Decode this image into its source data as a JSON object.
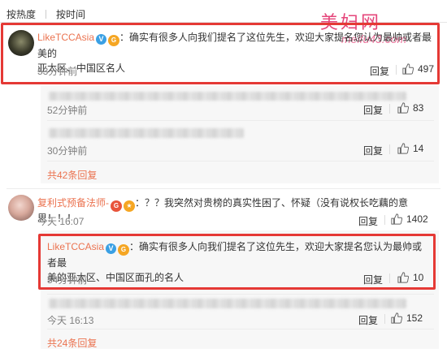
{
  "sort_tabs": [
    "按热度",
    "按时间"
  ],
  "watermark": {
    "title": "美妇网",
    "url": "meifu43.com"
  },
  "comment1": {
    "author": "LikeTCCAsia",
    "text_line1": "：确实有很多人向我们提名了这位先生，欢迎大家提名您认为最帅或者最美的",
    "text_line2": "亚太区、中国区名人",
    "time": "53分钟前",
    "reply_label": "回复",
    "likes": "497"
  },
  "sub_rows": [
    {
      "time": "52分钟前",
      "reply_label": "回复",
      "likes": "83"
    },
    {
      "time": "30分钟前",
      "reply_label": "回复",
      "likes": "14"
    }
  ],
  "more1": "共42条回复",
  "comment2": {
    "author": "复利式预备法师-",
    "text": "：？？我突然对贵榜的真实性困了、怀疑（没有说权长吃藕的意思！！！",
    "time": "今天 16:07",
    "reply_label": "回复",
    "likes": "1402"
  },
  "comment3": {
    "author": "LikeTCCAsia",
    "text_line1": "：确实有很多人向我们提名了这位先生，欢迎大家提名您认为最帅或者最",
    "text_line2": "美的亚太区、中国区面孔的名人",
    "time": "54分钟前",
    "reply_label": "回复",
    "likes": "10"
  },
  "sub_row3": {
    "time": "今天 16:13",
    "reply_label": "回复",
    "likes": "152"
  },
  "more2": "共24条回复",
  "colors": {
    "accent": "#eb7350",
    "highlight_box": "#e53935",
    "verified": "#3aa0e4",
    "watermark": "#e5457a"
  }
}
